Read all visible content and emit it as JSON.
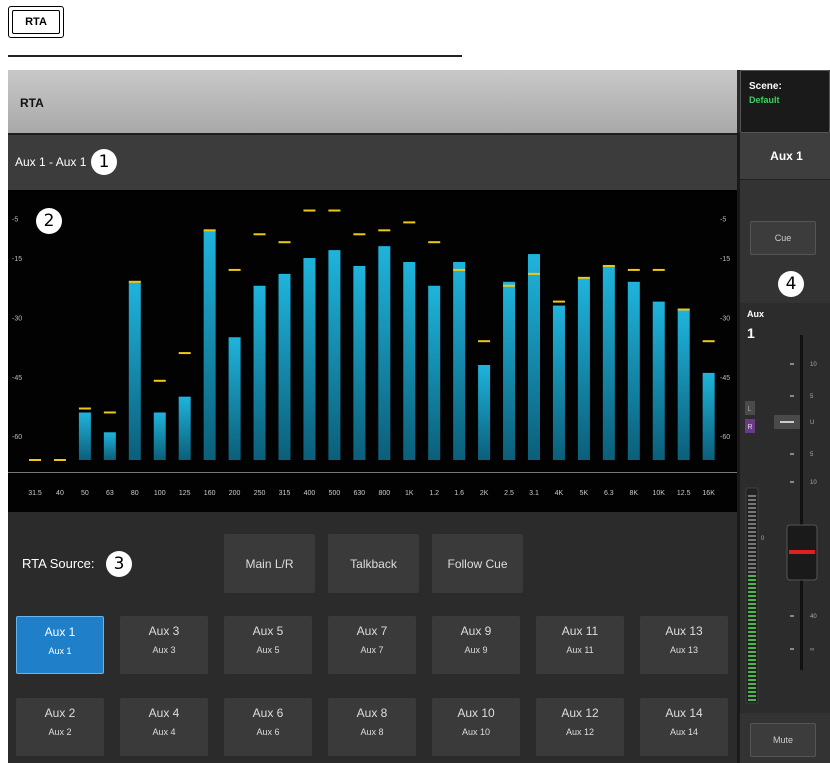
{
  "doc": {
    "tab_label": "RTA"
  },
  "header": {
    "title": "RTA"
  },
  "scene": {
    "label": "Scene:",
    "value": "Default"
  },
  "subheader": {
    "source_label": "Aux 1 - Aux 1"
  },
  "callouts": [
    "1",
    "2",
    "3",
    "4"
  ],
  "colors": {
    "accent": "#1f7fc8",
    "bar": "#1aa3cc",
    "peak": "#f0c814",
    "scene_value": "#3fd05f",
    "fader_line": "#e02020"
  },
  "chart_data": {
    "type": "bar",
    "categories": [
      "31.5",
      "40",
      "50",
      "63",
      "80",
      "100",
      "125",
      "160",
      "200",
      "250",
      "315",
      "400",
      "500",
      "630",
      "800",
      "1K",
      "1.2",
      "1.6",
      "2K",
      "2.5",
      "3.1",
      "4K",
      "5K",
      "6.3",
      "8K",
      "10K",
      "12.5",
      "16K"
    ],
    "series": [
      {
        "values": [
          -66,
          -66,
          -54,
          -59,
          -21,
          -54,
          -50,
          -8,
          -35,
          -22,
          -19,
          -15,
          -13,
          -17,
          -12,
          -16,
          -22,
          -16,
          -42,
          -21,
          -14,
          -27,
          -20,
          -17,
          -21,
          -26,
          -28,
          -44
        ]
      },
      {
        "values": [
          -66,
          -66,
          -53,
          -54,
          -21,
          -46,
          -39,
          -8,
          -18,
          -9,
          -11,
          -3,
          -3,
          -9,
          -8,
          -6,
          -11,
          -18,
          -36,
          -22,
          -19,
          -26,
          -20,
          -17,
          -18,
          -18,
          -28,
          -36
        ]
      }
    ],
    "y_ticks": [
      "-5",
      "-15",
      "-30",
      "-45",
      "-60"
    ],
    "ylim": [
      -66,
      0
    ]
  },
  "rta_source": {
    "label": "RTA Source:",
    "options": [
      "Main L/R",
      "Talkback",
      "Follow Cue"
    ]
  },
  "aux_buttons": {
    "row1": [
      {
        "name": "Aux 1",
        "sub": "Aux 1"
      },
      {
        "name": "Aux 3",
        "sub": "Aux 3"
      },
      {
        "name": "Aux 5",
        "sub": "Aux 5"
      },
      {
        "name": "Aux 7",
        "sub": "Aux 7"
      },
      {
        "name": "Aux 9",
        "sub": "Aux 9"
      },
      {
        "name": "Aux 11",
        "sub": "Aux 11"
      },
      {
        "name": "Aux 13",
        "sub": "Aux 13"
      }
    ],
    "row2": [
      {
        "name": "Aux 2",
        "sub": "Aux 2"
      },
      {
        "name": "Aux 4",
        "sub": "Aux 4"
      },
      {
        "name": "Aux 6",
        "sub": "Aux 6"
      },
      {
        "name": "Aux 8",
        "sub": "Aux 8"
      },
      {
        "name": "Aux 10",
        "sub": "Aux 10"
      },
      {
        "name": "Aux 12",
        "sub": "Aux 12"
      },
      {
        "name": "Aux 14",
        "sub": "Aux 14"
      }
    ],
    "selected": "Aux 1"
  },
  "channel": {
    "name": "Aux 1",
    "cue_label": "Cue",
    "mute_label": "Mute",
    "strip_label": "Aux",
    "strip_number": "1",
    "lr_labels": [
      "L",
      "R"
    ],
    "fader_scale": [
      "10",
      "5",
      "U",
      "5",
      "10",
      "40",
      "∞"
    ],
    "meter_zero": "0"
  }
}
